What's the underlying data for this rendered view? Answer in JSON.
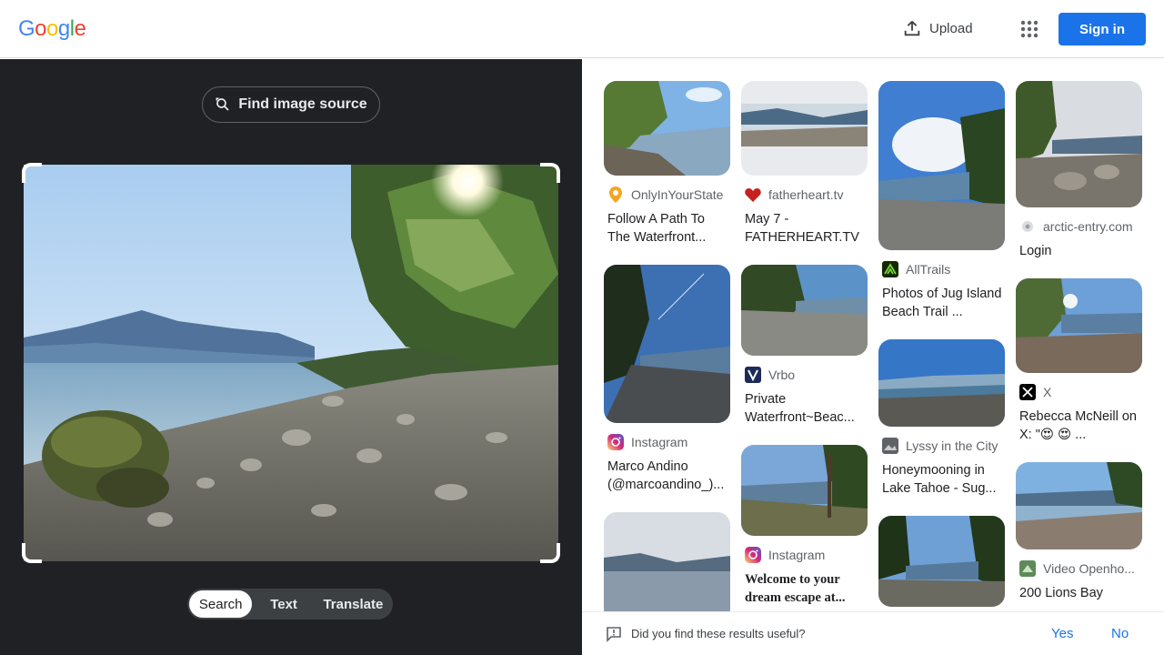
{
  "header": {
    "logo": [
      "G",
      "o",
      "o",
      "g",
      "l",
      "e"
    ],
    "logo_colors": [
      "#4285f4",
      "#ea4335",
      "#fbbc05",
      "#4285f4",
      "#34a853",
      "#ea4335"
    ],
    "upload_label": "Upload",
    "signin_label": "Sign in"
  },
  "left": {
    "find_source_label": "Find image source",
    "tabs": [
      "Search",
      "Text",
      "Translate"
    ],
    "active_tab": "Search"
  },
  "results": [
    {
      "source": "OnlyInYourState",
      "title": "Follow A Path To The Waterfront...",
      "icon": "map-pin-icon"
    },
    {
      "source": "fatherheart.tv",
      "title": "May 7 - FATHERHEART.TV",
      "icon": "heart-icon"
    },
    {
      "source": "AllTrails",
      "title": "Photos of Jug Island Beach Trail ...",
      "icon": "alltrails-icon"
    },
    {
      "source": "arctic-entry.com",
      "title": "Login",
      "icon": "globe-icon"
    },
    {
      "source": "Instagram",
      "title": "Marco Andino (@marcoandino_)...",
      "icon": "instagram-icon"
    },
    {
      "source": "Vrbo",
      "title": "Private Waterfront~Beac...",
      "icon": "vrbo-icon"
    },
    {
      "source": "Lyssy in the City",
      "title": "Honeymooning in Lake Tahoe - Sug...",
      "icon": "site-icon"
    },
    {
      "source": "X",
      "title": "Rebecca McNeill on X: \"😍 😍 ...",
      "icon": "x-icon"
    },
    {
      "source": "Instagram",
      "title": "Welcome to your dream escape at...",
      "icon": "instagram-icon"
    },
    {
      "source": "Video Openho...",
      "title": "200 Lions Bay",
      "icon": "openhouse-icon"
    }
  ],
  "feedback": {
    "question": "Did you find these results useful?",
    "yes": "Yes",
    "no": "No"
  },
  "colors": {
    "accent": "#1a73e8",
    "dark_panel": "#202124"
  }
}
